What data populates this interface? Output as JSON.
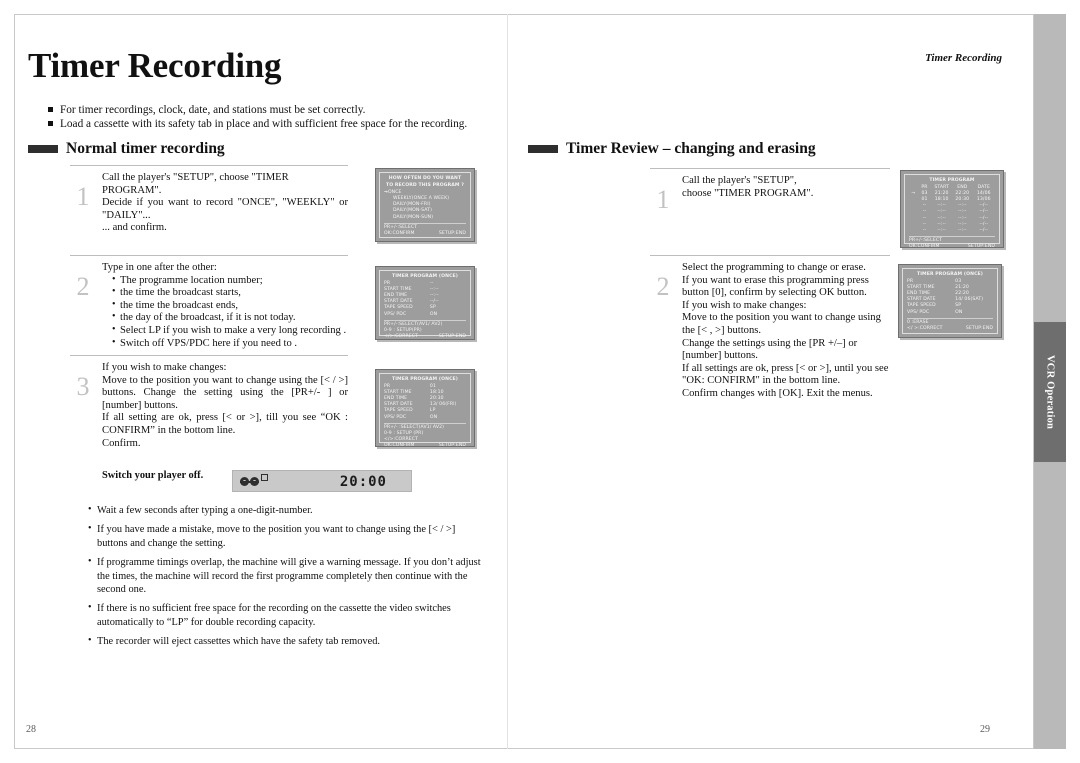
{
  "document": {
    "title": "Timer Recording",
    "running_head": "Timer Recording",
    "side_tab": "VCR Operation",
    "page_left": "28",
    "page_right": "29"
  },
  "intro": [
    "For timer recordings, clock, date, and stations must be set correctly.",
    "Load a cassette with its safety tab in place and with sufficient free space for the recording."
  ],
  "left_section": {
    "heading": "Normal timer recording",
    "steps": [
      {
        "num": "1",
        "lines": [
          "Call the player's \"SETUP\", choose \"TIMER PROGRAM\".",
          "Decide if you want to record  \"ONCE\", \"WEEKLY\" or \"DAILY\"...",
          "... and confirm."
        ]
      },
      {
        "num": "2",
        "intro": "Type in one after the other:",
        "bullets": [
          "The programme location number;",
          "the time the broadcast starts,",
          "the time the broadcast ends,",
          "the day of the broadcast, if it is not today.",
          "Select LP if you wish to make a very long recording .",
          "Switch off VPS/PDC here if you need to ."
        ]
      },
      {
        "num": "3",
        "lines": [
          "If you wish to make changes:",
          "Move to the position you want to change using the  [< / >] buttons. Change the setting using the [PR+/- ] or [number] buttons.",
          "If all setting are ok, press [< or  >], till you see “OK : CONFIRM” in the bottom line.",
          "Confirm."
        ]
      }
    ],
    "switch_off_label": "Switch your player off.",
    "vfd_clock": "20:00",
    "notes": [
      "Wait a few seconds after typing a one-digit-number.",
      "If you have made a mistake, move to the position you want to change using the [< / >] buttons and change the setting.",
      "If programme timings overlap, the machine will give a warning message. If you don’t adjust the times, the machine will record the first programme completely then continue with the second one.",
      "If there is no sufficient free space for the recording on the cassette the video switches automatically to “LP” for double recording capacity.",
      "The recorder will eject cassettes which have the safety tab removed."
    ]
  },
  "right_section": {
    "heading": "Timer Review – changing and erasing",
    "steps": [
      {
        "num": "1",
        "lines": [
          "Call the player's \"SETUP\",",
          "choose \"TIMER PROGRAM\"."
        ]
      },
      {
        "num": "2",
        "lines": [
          "Select the programming to change or erase.",
          "If you want to erase this programming press",
          "button  [0], confirm by selecting OK button.",
          "If you wish to make changes:",
          "Move to the position you want to change using the [< , >] buttons.",
          "Change the settings using the [PR +/–] or [number]  buttons.",
          "If all settings are ok, press [< or >], until you see \"OK: CONFIRM\" in the bottom line.",
          "Confirm changes with [OK]. Exit the menus."
        ]
      }
    ]
  },
  "osd_panels": {
    "how_often": {
      "line1": "HOW OFTEN DO YOU WANT",
      "line2": "TO RECORD THIS PROGRAM ?",
      "options": [
        "ONCE",
        "WEEKLY(ONCE A WEEK)",
        "DAILY(MON-FRI)",
        "DAILY(MON-SAT)",
        "DAILY(MON-SUN)"
      ],
      "selected": "ONCE",
      "foot_left": "PR+/-:SELECT",
      "foot_ok": "OK:CONFIRM",
      "foot_right": "SETUP:END"
    },
    "program_empty": {
      "title": "TIMER PROGRAM  (ONCE)",
      "rows": [
        {
          "k": "PR",
          "v": "--"
        },
        {
          "k": "START TIME",
          "v": "--:--"
        },
        {
          "k": "END TIME",
          "v": "--:--"
        },
        {
          "k": "START DATE",
          "v": "--/--"
        },
        {
          "k": "TAPE SPEED",
          "v": "SP"
        },
        {
          "k": "VPS/ PDC",
          "v": "ON"
        }
      ],
      "foot1": "PR+/-:SELECT(AV1/ AV2)",
      "foot2": "0-9  : SETUP(PR)",
      "foot3_left": "</>:CORRECT",
      "foot3_right": "SETUP:END"
    },
    "program_filled": {
      "title": "TIMER PROGRAM  (ONCE)",
      "rows": [
        {
          "k": "PR",
          "v": "01"
        },
        {
          "k": "START TIME",
          "v": "18:10"
        },
        {
          "k": "END TIME",
          "v": "20:30"
        },
        {
          "k": "START DATE",
          "v": "13/ 06(FRI)"
        },
        {
          "k": "TAPE SPEED",
          "v": "LP"
        },
        {
          "k": "VPS/ PDC",
          "v": "ON"
        }
      ],
      "foot1": "PR+/- :SELECT(AV1/ AV2)",
      "foot2": "0-9  : SETUP (PR)",
      "foot3": "</>:CORRECT",
      "foot4_left": "OK:CONFIRM",
      "foot4_right": "SETUP:END"
    },
    "program_list": {
      "title": "TIMER PROGRAM",
      "columns": [
        "PR",
        "START",
        "END",
        "DATE"
      ],
      "rows": [
        {
          "marker": "→",
          "pr": "03",
          "start": "21:20",
          "end": "22:20",
          "date": "14/06"
        },
        {
          "marker": "",
          "pr": "01",
          "start": "18:10",
          "end": "20:30",
          "date": "13/06"
        },
        {
          "marker": "",
          "pr": "--",
          "start": "--:--",
          "end": "--:--",
          "date": "--/--"
        },
        {
          "marker": "",
          "pr": "--",
          "start": "--:--",
          "end": "--:--",
          "date": "--/--"
        },
        {
          "marker": "",
          "pr": "--",
          "start": "--:--",
          "end": "--:--",
          "date": "--/--"
        },
        {
          "marker": "",
          "pr": "--",
          "start": "--:--",
          "end": "--:--",
          "date": "--/--"
        },
        {
          "marker": "",
          "pr": "--",
          "start": "--:--",
          "end": "--:--",
          "date": "--/--"
        }
      ],
      "foot_left": "PR+/-:SELECT",
      "foot_ok": "OK:CONFIRM",
      "foot_right": "SETUP:END"
    },
    "program_selected": {
      "title": "TIMER PROGRAM  (ONCE)",
      "rows": [
        {
          "k": "PR",
          "v": "03"
        },
        {
          "k": "START TIME",
          "v": "21:20"
        },
        {
          "k": "END TIME",
          "v": "22:20"
        },
        {
          "k": "START DATE",
          "v": "14/ 06(SAT)"
        },
        {
          "k": "TAPE SPEED",
          "v": "SP"
        },
        {
          "k": "VPS/ PDC",
          "v": "ON"
        }
      ],
      "foot1": "0  :ERASE",
      "foot2_left": "</ >:CORRECT",
      "foot2_right": "SETUP:END"
    }
  },
  "colors": {
    "osd_background": "#9d9d9d",
    "side_tab": "#6e6e6e",
    "heading_bar": "#2e2e2e"
  }
}
